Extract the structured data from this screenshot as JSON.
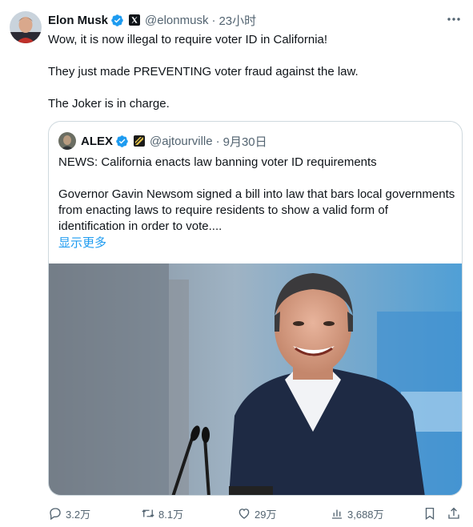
{
  "tweet": {
    "author_name": "Elon Musk",
    "handle": "@elonmusk",
    "separator": "·",
    "time": "23小时",
    "lines": [
      "Wow, it is now illegal to require voter ID in California!",
      "They just made PREVENTING voter fraud against the law.",
      "The Joker is in charge."
    ]
  },
  "quote": {
    "author_name": "ALEX",
    "handle": "@ajtourville",
    "separator": "·",
    "date": "9月30日",
    "headline": "NEWS: California enacts law banning voter ID requirements",
    "body": "Governor Gavin Newsom signed a bill into law that bars local governments from enacting laws to require residents to show a valid form of identification in order to vote....",
    "show_more": "显示更多"
  },
  "actions": {
    "replies": "3.2万",
    "reposts": "8.1万",
    "likes": "29万",
    "views": "3,688万"
  },
  "colors": {
    "text": "#0f1419",
    "secondary": "#536471",
    "link": "#1d9bf0",
    "border": "#cfd9de",
    "verified": "#1d9bf0"
  },
  "icons": [
    "verified-badge-icon",
    "x-logo-icon",
    "more-icon",
    "reply-icon",
    "repost-icon",
    "like-icon",
    "views-icon",
    "bookmark-icon",
    "share-icon"
  ]
}
